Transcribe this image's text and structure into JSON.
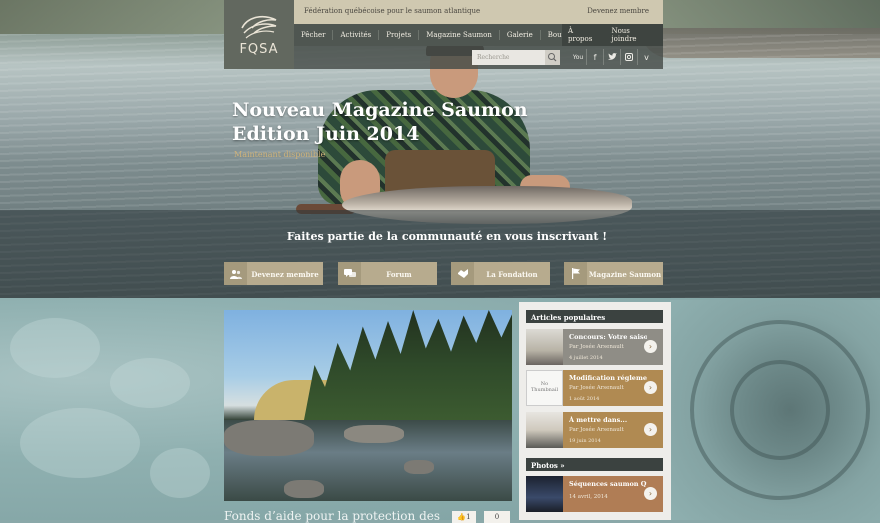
{
  "header": {
    "logo_text": "FQSA",
    "org_name": "Fédération québécoise pour le saumon atlantique",
    "become_member": "Devenez membre",
    "nav": [
      "Pêcher",
      "Activités",
      "Projets",
      "Magazine Saumon",
      "Galerie",
      "Boutique"
    ],
    "nav_right": [
      "À propos",
      "Nous joindre"
    ],
    "search_placeholder": "Recherche",
    "socials": [
      "youtube-icon",
      "facebook-icon",
      "twitter-icon",
      "instagram-icon",
      "vimeo-icon"
    ]
  },
  "hero": {
    "title": "Nouveau Magazine Saumon Edition Juin 2014",
    "subtitle": "Maintenant disponible",
    "band_text": "Faites partie de la communauté en vous inscrivant !",
    "ctas": [
      {
        "label": "Devenez membre",
        "icon": "members-icon"
      },
      {
        "label": "Forum",
        "icon": "forum-icon"
      },
      {
        "label": "La Fondation",
        "icon": "foundation-icon"
      },
      {
        "label": "Magazine Saumon",
        "icon": "flag-icon"
      }
    ]
  },
  "post": {
    "title": "Fonds d’aide pour la protection des",
    "likes": "1",
    "comments": "0"
  },
  "sidebar": {
    "popular_title": "Articles populaires",
    "articles": [
      {
        "title": "Concours: Votre saison...",
        "author": "Par Josée Arsenault",
        "date": "4 juillet 2014",
        "thumb": ""
      },
      {
        "title": "Modification réglementaire -...",
        "author": "Par Josée Arsenault",
        "date": "1 août 2014",
        "thumb": "No Thumbnail"
      },
      {
        "title": "À mettre dans...",
        "author": "Par Josée Arsenault",
        "date": "19 juin 2014",
        "thumb": ""
      }
    ],
    "photos_title": "Photos »",
    "photos": [
      {
        "title": "Séquences saumon Québec",
        "date": "14 avril, 2014"
      }
    ]
  },
  "colors": {
    "accent": "#b08a52",
    "nav_bg": "#4f5651",
    "topbar_bg": "#cfc8b0",
    "cta_bg": "#b7ab8e"
  }
}
